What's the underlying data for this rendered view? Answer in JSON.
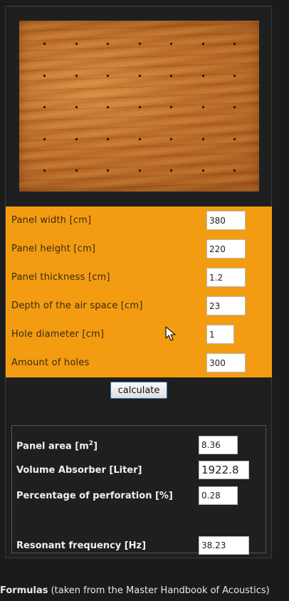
{
  "inputs": {
    "panel_width": {
      "label": "Panel width [cm]",
      "value": "380"
    },
    "panel_height": {
      "label": "Panel height [cm]",
      "value": "220"
    },
    "panel_thickness": {
      "label": "Panel thickness [cm]",
      "value": "1.2"
    },
    "air_space_depth": {
      "label": "Depth of the air space [cm]",
      "value": "23"
    },
    "hole_diameter": {
      "label": "Hole diameter [cm]",
      "value": "1"
    },
    "amount_of_holes": {
      "label": "Amount of holes",
      "value": "300"
    }
  },
  "calculate_label": "calculate",
  "results": {
    "panel_area": {
      "label_prefix": "Panel area [m",
      "label_sup": "2",
      "label_suffix": "]",
      "value": "8.36"
    },
    "volume_absorber": {
      "label": "Volume Absorber [Liter]",
      "value": "1922.8"
    },
    "perforation": {
      "label": "Percentage of perforation [%]",
      "value": "0.28"
    },
    "resonant_frequency": {
      "label": "Resonant frequency [Hz]",
      "value": "38.23"
    }
  },
  "footer": {
    "bold": "Formulas",
    "rest": " (taken from the Master Handbook of Acoustics)"
  },
  "colors": {
    "input_panel_bg": "#f39c11",
    "page_bg": "#1b1b1b",
    "button_border": "#3a6fb8"
  }
}
